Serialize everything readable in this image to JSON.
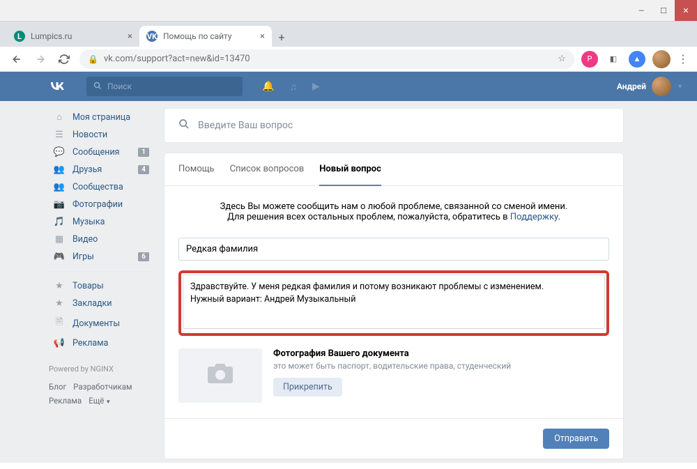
{
  "window": {
    "min": "—",
    "max": "☐",
    "close": "✕"
  },
  "browser_tabs": [
    {
      "title": "Lumpics.ru",
      "favicon": "L",
      "favcolor": "#008c78",
      "favfg": "#fff",
      "active": false
    },
    {
      "title": "Помощь по сайту",
      "favicon": "VK",
      "favcolor": "#4a76a8",
      "favfg": "#fff",
      "active": true
    }
  ],
  "addressbar": {
    "url": "vk.com/support?act=new&id=13470"
  },
  "vk_header": {
    "logo": "VK",
    "search_placeholder": "Поиск",
    "username": "Андрей"
  },
  "sidebar": {
    "items_a": [
      {
        "icon": "⌂",
        "label": "Моя страница"
      },
      {
        "icon": "☰",
        "label": "Новости"
      },
      {
        "icon": "💬",
        "label": "Сообщения",
        "badge": "1"
      },
      {
        "icon": "👥",
        "label": "Друзья",
        "badge": "4"
      },
      {
        "icon": "👥",
        "label": "Сообщества"
      },
      {
        "icon": "📷",
        "label": "Фотографии"
      },
      {
        "icon": "🎵",
        "label": "Музыка"
      },
      {
        "icon": "▦",
        "label": "Видео"
      },
      {
        "icon": "🎮",
        "label": "Игры",
        "badge": "6"
      }
    ],
    "items_b": [
      {
        "icon": "★",
        "label": "Товары"
      },
      {
        "icon": "★",
        "label": "Закладки"
      },
      {
        "icon": "🗎",
        "label": "Документы"
      },
      {
        "icon": "📢",
        "label": "Реклама"
      }
    ],
    "powered": "Powered by NGINX",
    "footer": [
      "Блог",
      "Разработчикам",
      "Реклама",
      "Ещё"
    ]
  },
  "support": {
    "search_placeholder": "Введите Ваш вопрос",
    "tabs": [
      "Помощь",
      "Список вопросов",
      "Новый вопрос"
    ],
    "active_tab": 2,
    "intro_line1": "Здесь Вы можете сообщить нам о любой проблеме, связанной со сменой имени.",
    "intro_line2_a": "Для решения всех остальных проблем, пожалуйста, обратитесь в ",
    "intro_link": "Поддержку",
    "subject": "Редкая фамилия",
    "message": "Здравствуйте. У меня редкая фамилия и потому возникают проблемы с изменением.\nНужный вариант: Андрей Музыкальный",
    "doc_title": "Фотография Вашего документа",
    "doc_sub": "это может быть паспорт, водительские права, студенческий",
    "attach": "Прикрепить",
    "submit": "Отправить"
  }
}
